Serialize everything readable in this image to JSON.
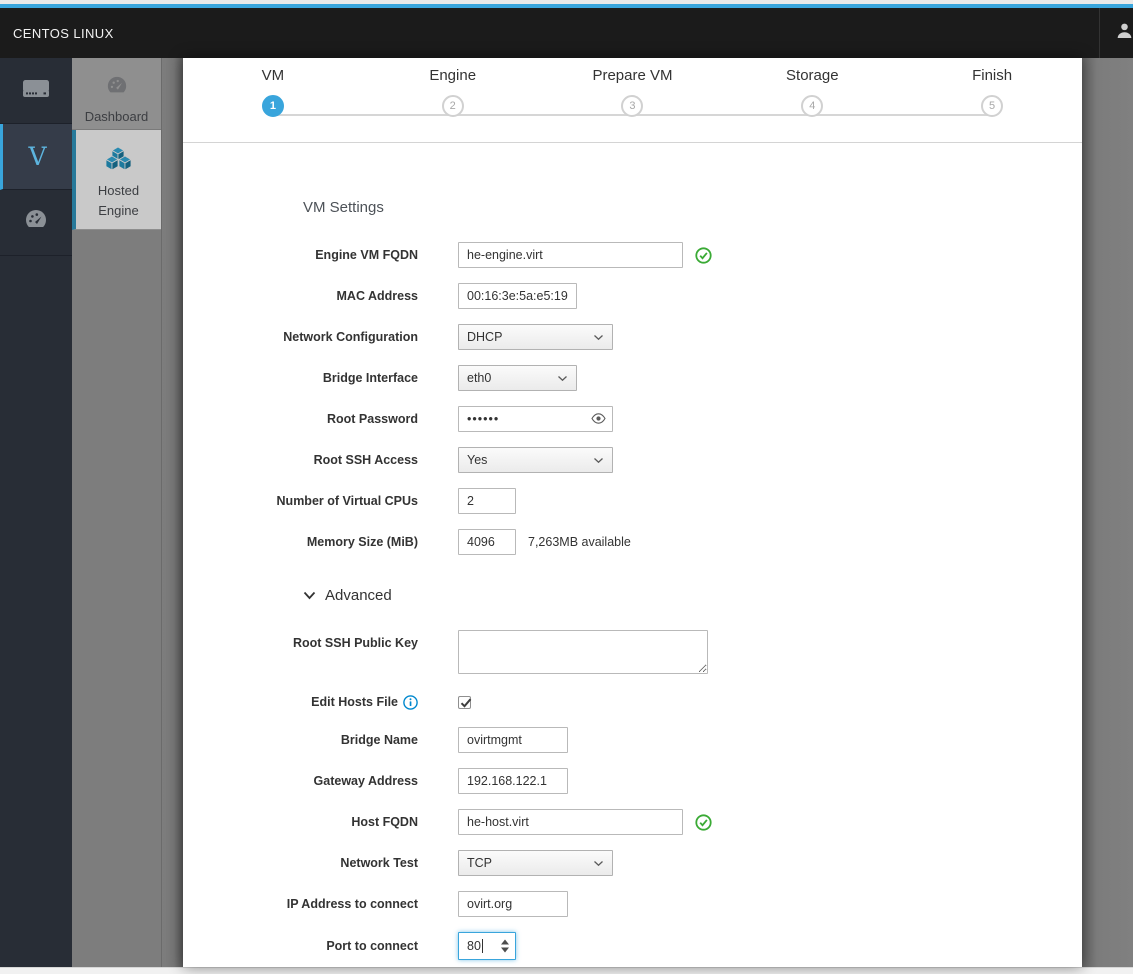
{
  "colors": {
    "accent": "#39a5dc",
    "success": "#3aaa35",
    "info": "#0088ce",
    "navbar": "#1b1b1b",
    "sidebar": "#282d36"
  },
  "topbar": {
    "brand": "CENTOS LINUX"
  },
  "primary_nav": {
    "items": [
      {
        "icon": "server-icon"
      },
      {
        "label": "V",
        "active": true
      },
      {
        "icon": "dashboard-gauge-icon"
      }
    ]
  },
  "secondary_nav": {
    "dashboard": {
      "label": "Dashboard",
      "icon": "dashboard-gauge-icon"
    },
    "hosted_engine": {
      "label_line1": "Hosted",
      "label_line2": "Engine",
      "icon": "cubes-icon",
      "active": true
    }
  },
  "wizard": {
    "steps": [
      {
        "label": "VM",
        "number": "1",
        "active": true
      },
      {
        "label": "Engine",
        "number": "2"
      },
      {
        "label": "Prepare VM",
        "number": "3"
      },
      {
        "label": "Storage",
        "number": "4"
      },
      {
        "label": "Finish",
        "number": "5"
      }
    ],
    "section_title": "VM Settings",
    "fields": {
      "engine_fqdn": {
        "label": "Engine VM FQDN",
        "value": "he-engine.virt",
        "valid": true
      },
      "mac": {
        "label": "MAC Address",
        "value": "00:16:3e:5a:e5:19"
      },
      "netconf": {
        "label": "Network Configuration",
        "value": "DHCP"
      },
      "bridge_if": {
        "label": "Bridge Interface",
        "value": "eth0"
      },
      "root_pw": {
        "label": "Root Password",
        "value": "••••••"
      },
      "ssh_access": {
        "label": "Root SSH Access",
        "value": "Yes"
      },
      "cpus": {
        "label": "Number of Virtual CPUs",
        "value": "2"
      },
      "memory": {
        "label": "Memory Size (MiB)",
        "value": "4096",
        "note": "7,263MB available"
      }
    },
    "advanced": {
      "title": "Advanced",
      "ssh_key": {
        "label": "Root SSH Public Key",
        "value": ""
      },
      "edit_hosts": {
        "label": "Edit Hosts File",
        "checked": "checked"
      },
      "bridge_name": {
        "label": "Bridge Name",
        "value": "ovirtmgmt"
      },
      "gateway": {
        "label": "Gateway Address",
        "value": "192.168.122.1"
      },
      "host_fqdn": {
        "label": "Host FQDN",
        "value": "he-host.virt",
        "valid": true
      },
      "net_test": {
        "label": "Network Test",
        "value": "TCP"
      },
      "ip_connect": {
        "label": "IP Address to connect",
        "value": "ovirt.org"
      },
      "port_connect": {
        "label": "Port to connect",
        "value": "80",
        "focused": true
      }
    }
  }
}
